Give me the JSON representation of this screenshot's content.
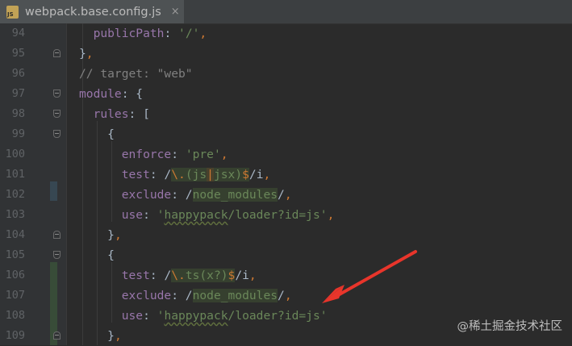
{
  "tab": {
    "icon": "js-file-icon",
    "icon_text": "JS",
    "title": "webpack.base.config.js",
    "close": "×"
  },
  "colors": {
    "background": "#2b2b2b",
    "gutter": "#313335",
    "arrow": "#e8352b"
  },
  "lines": [
    {
      "num": "94"
    },
    {
      "num": "95"
    },
    {
      "num": "96"
    },
    {
      "num": "97"
    },
    {
      "num": "98"
    },
    {
      "num": "99"
    },
    {
      "num": "100"
    },
    {
      "num": "101"
    },
    {
      "num": "102"
    },
    {
      "num": "103"
    },
    {
      "num": "104"
    },
    {
      "num": "105"
    },
    {
      "num": "106"
    },
    {
      "num": "107"
    },
    {
      "num": "108"
    },
    {
      "num": "109"
    }
  ],
  "tokens": {
    "publicPath": "publicPath",
    "publicPath_val": "'/'",
    "target_comment": "// target: \"web\"",
    "module": "module",
    "rules": "rules",
    "enforce": "enforce",
    "enforce_val": "'pre'",
    "test": "test",
    "exclude": "exclude",
    "use": "use",
    "rx1_a": "\\.",
    "rx1_b": "(js",
    "rx1_pipe": "|",
    "rx1_c": "jsx)",
    "rx1_d": "$",
    "rx_flags": "/i",
    "node_modules": "node_modules",
    "happypack": "happypack",
    "loader_rest": "/loader?id=js",
    "rx2_a": "\\.",
    "rx2_b": "ts(x?)",
    "rx2_d": "$"
  },
  "watermark": "@稀土掘金技术社区"
}
